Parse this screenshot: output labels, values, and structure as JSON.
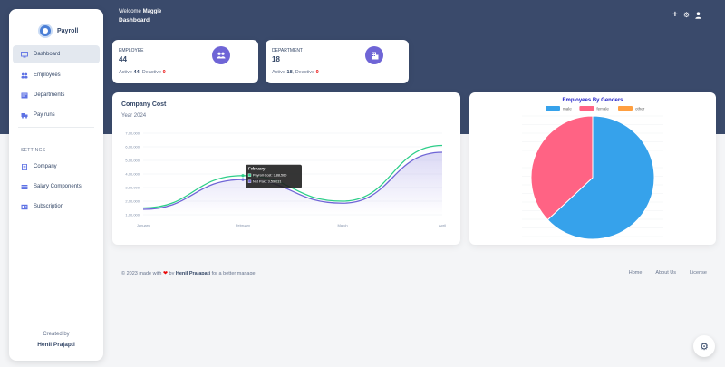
{
  "brand": {
    "name": "Payroll"
  },
  "sidebar": {
    "items": [
      {
        "label": "Dashboard",
        "icon": "monitor-icon",
        "active": true
      },
      {
        "label": "Employees",
        "icon": "users-icon"
      },
      {
        "label": "Departments",
        "icon": "building-icon"
      },
      {
        "label": "Pay runs",
        "icon": "truck-icon"
      }
    ],
    "settings_label": "SETTINGS",
    "settings_items": [
      {
        "label": "Company",
        "icon": "document-icon"
      },
      {
        "label": "Salary Components",
        "icon": "card-icon"
      },
      {
        "label": "Subscription",
        "icon": "receipt-icon"
      }
    ],
    "created_label": "Created by",
    "creator": "Henil Prajapti"
  },
  "header": {
    "welcome_prefix": "Welcome",
    "user": "Maggie",
    "title": "Dashboard"
  },
  "stats": {
    "employee": {
      "title": "EMPLOYEE",
      "value": "44",
      "active_label": "Active",
      "active": "44",
      "deactive_label": ", Deactive",
      "deactive": "0",
      "icon": "users-icon"
    },
    "department": {
      "title": "DEPARTMENT",
      "value": "18",
      "active_label": "Active",
      "active": "18",
      "deactive_label": ", Deactive",
      "deactive": "0",
      "icon": "building-icon"
    }
  },
  "company_cost": {
    "title": "Company Cost",
    "year": "Year 2024",
    "tooltip": {
      "title": "February",
      "payroll_label": "Payroll Cost",
      "payroll_value": "3,88,560",
      "net_label": "Net Paid",
      "net_value": "3,59,031"
    }
  },
  "gender_chart": {
    "title": "Employees By Genders"
  },
  "chart_data": [
    {
      "type": "line",
      "x": [
        "January",
        "February",
        "March",
        "April"
      ],
      "yticks": [
        "1,00,000",
        "2,00,000",
        "3,00,000",
        "4,00,000",
        "5,00,000",
        "6,00,000",
        "7,00,000"
      ],
      "ylim": [
        100000,
        700000
      ],
      "series": [
        {
          "name": "Payroll Cost",
          "values": [
            150000,
            388560,
            200000,
            610000
          ],
          "color": "#2dce89"
        },
        {
          "name": "Net Paid",
          "values": [
            140000,
            359031,
            185000,
            560000
          ],
          "color": "#6f65d6"
        }
      ]
    },
    {
      "type": "pie",
      "title": "Employees By Genders",
      "labels": [
        "male",
        "female",
        "other"
      ],
      "values": [
        63,
        37,
        0
      ],
      "colors": [
        "#36a2eb",
        "#ff6384",
        "#ff9f40"
      ],
      "legend": "top"
    }
  ],
  "footer": {
    "copyright": "© 2023 made with",
    "by": "by",
    "author": "Henil Prajapati",
    "suffix": "for a better manage",
    "links": [
      "Home",
      "About Us",
      "License"
    ]
  }
}
